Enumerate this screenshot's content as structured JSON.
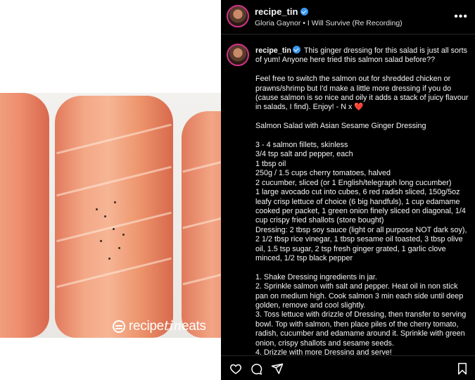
{
  "post": {
    "username": "recipe_tin",
    "music": "Gloria Gaynor • I Will Survive (Re Recording)",
    "caption_intro": " This ginger dressing for this salad is just all sorts of yum! Anyone here tried this salmon salad before??",
    "caption_body": "Feel free to switch the salmon out for shredded chicken or prawns/shrimp but I'd make a little more dressing if you do (cause salmon is so nice and oily it adds a stack of juicy flavour in salads, I find). Enjoy! - N x ❤️\n\nSalmon Salad with Asian Sesame Ginger Dressing\n\n3 - 4 salmon fillets, skinless\n3/4 tsp salt and pepper, each\n1 tbsp oil\n250g / 1.5 cups cherry tomatoes, halved\n2 cucumber, sliced (or 1 English/telegraph long cucumber)\n1 large avocado cut into cubes, 6 red radish sliced, 150g/5oz leafy crisp lettuce of choice (6 big handfuls), 1 cup edamame cooked per packet, 1 green onion finely sliced on diagonal, 1/4 cup crispy fried shallots (store bought)\nDressing: 2 tbsp soy sauce (light or all purpose NOT dark soy), 2 1/2 tbsp rice vinegar, 1 tbsp sesame oil toasted, 3 tbsp olive oil, 1.5 tsp sugar, 2 tsp fresh ginger grated, 1 garlic clove minced, 1/2 tsp black pepper\n\n1. Shake Dressing ingredients in jar.\n2. Sprinkle salmon with salt and pepper. Heat oil in non stick pan on medium high. Cook salmon 3 min each side until deep golden, remove and cool slightly.\n3. Toss lettuce with drizzle of Dressing, then transfer to serving bowl. Top with salmon, then place piles of the cherry tomato, radish, cucumber and edamame around it. Sprinkle with green onion, crispy shallots and sesame seeds.\n4. Drizzle with more Dressing and serve!"
  },
  "media": {
    "watermark_logo_text": "recipetineats"
  },
  "icons": {
    "more": "more-options-icon",
    "like": "heart-icon",
    "comment": "comment-icon",
    "share": "share-icon",
    "save": "bookmark-icon"
  },
  "colors": {
    "panel_bg": "#000000",
    "verified": "#3897f0",
    "salmon": "#ee976f"
  }
}
